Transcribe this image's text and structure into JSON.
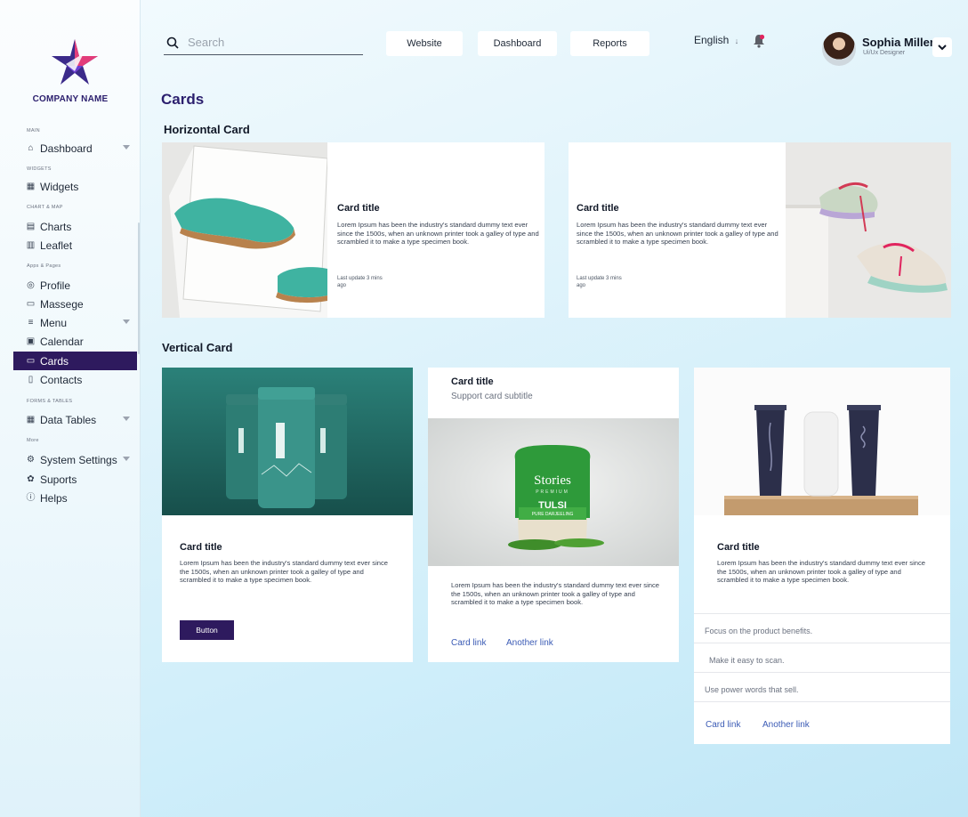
{
  "brand": {
    "company_name": "COMPANY NAME",
    "accent": "#2e1a5e"
  },
  "sidebar": {
    "sections": {
      "main": "MAIN",
      "widgets": "WIDGETS",
      "chart_map": "CHART & MAP",
      "apps_pages": "Apps & Pages",
      "forms_tables": "FORMS & TABLES",
      "more": "More"
    },
    "items": [
      {
        "label": "Dashboard",
        "icon": "home-icon"
      },
      {
        "label": "Widgets",
        "icon": "grid-icon"
      },
      {
        "label": "Charts",
        "icon": "chart-icon"
      },
      {
        "label": "Leaflet",
        "icon": "map-icon"
      },
      {
        "label": "Profile",
        "icon": "user-icon"
      },
      {
        "label": "Massege",
        "icon": "message-icon"
      },
      {
        "label": "Menu",
        "icon": "menu-icon"
      },
      {
        "label": "Calendar",
        "icon": "calendar-icon"
      },
      {
        "label": "Cards",
        "icon": "card-icon"
      },
      {
        "label": "Contacts",
        "icon": "contacts-icon"
      },
      {
        "label": "Data Tables",
        "icon": "table-icon"
      },
      {
        "label": "System Settings",
        "icon": "gear-icon"
      },
      {
        "label": "Suports",
        "icon": "support-icon"
      },
      {
        "label": "Helps",
        "icon": "help-icon"
      }
    ]
  },
  "header": {
    "search_placeholder": "Search",
    "nav": [
      "Website",
      "Dashboard",
      "Reports"
    ],
    "language": "English",
    "user": {
      "name": "Sophia Miller",
      "role": "Ui/Ux Designer"
    }
  },
  "page": {
    "title": "Cards",
    "horizontal_title": "Horizontal Card",
    "vertical_title": "Vertical Card"
  },
  "cards": {
    "h1": {
      "title": "Card title",
      "text": "Lorem Ipsum has been the industry's standard dummy text ever since the 1500s, when an unknown printer took a galley of type and scrambled it to make a type specimen book.",
      "meta1": "Last update 3 mins",
      "meta2": "ago"
    },
    "h2": {
      "title": "Card title",
      "text": "Lorem Ipsum has been the industry's standard dummy text ever since the 1500s, when an unknown printer took a galley of type and scrambled it to make a type specimen book.",
      "meta1": "Last update 3 mins",
      "meta2": "ago"
    },
    "v1": {
      "title": "Card title",
      "text": "Lorem Ipsum has been the industry's standard dummy text ever since the 1500s, when an unknown printer took a galley of type and scrambled it to make a type specimen book.",
      "button": "Button"
    },
    "v2": {
      "title": "Card title",
      "subtitle": "Support card subtitle",
      "text": "Lorem Ipsum has been the industry's standard dummy text ever since the 1500s, when an unknown printer took a galley of type and scrambled it to make a type specimen book.",
      "link1": "Card link",
      "link2": "Another link",
      "package_brand": "Stories",
      "package_sub": "PREMIUM",
      "package_name": "TULSI",
      "package_desc": "PURE DARJEELING"
    },
    "v3": {
      "title": "Card title",
      "text": "Lorem Ipsum has been the industry's standard dummy text ever since the 1500s, when an unknown printer took a galley of type and scrambled it to make a type specimen book.",
      "list": [
        "Focus on the product benefits.",
        "Make it easy to scan.",
        "Use power words that sell."
      ],
      "link1": "Card link",
      "link2": "Another link"
    }
  }
}
